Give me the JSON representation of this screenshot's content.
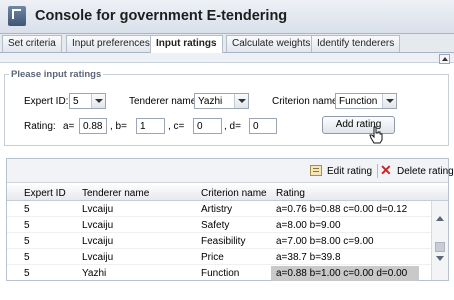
{
  "app": {
    "title": "Console for government E-tendering",
    "logo_icon": "app-logo-icon"
  },
  "tabs": [
    {
      "label": "Set criteria",
      "active": false
    },
    {
      "label": "Input preferences",
      "active": false
    },
    {
      "label": "Input ratings",
      "active": true
    },
    {
      "label": "Calculate weights",
      "active": false
    },
    {
      "label": "Identify tenderers",
      "active": false
    }
  ],
  "form": {
    "legend": "Please input ratings",
    "expert_id_label": "Expert ID:",
    "expert_id_value": "5",
    "tenderer_label": "Tenderer name:",
    "tenderer_value": "Yazhi",
    "criterion_label": "Criterion name:",
    "criterion_value": "Function",
    "rating_label": "Rating:",
    "a_label": "a=",
    "a_value": "0.88",
    "b_label": ", b=",
    "b_value": "1",
    "c_label": ", c=",
    "c_value": "0",
    "d_label": ", d=",
    "d_value": "0",
    "add_button": "Add rating"
  },
  "toolbar": {
    "edit_label": "Edit rating",
    "edit_icon": "edit-icon",
    "delete_label": "Delete rating",
    "delete_icon": "delete-x-icon",
    "delete_color": "#cc2222"
  },
  "table": {
    "columns": [
      "Expert ID",
      "Tenderer name",
      "Criterion name",
      "Rating"
    ],
    "rows": [
      [
        "5",
        "Lvcaiju",
        "Artistry",
        "a=0.76 b=0.88 c=0.00 d=0.12"
      ],
      [
        "5",
        "Lvcaiju",
        "Safety",
        "a=8.00 b=9.00"
      ],
      [
        "5",
        "Lvcaiju",
        "Feasibility",
        "a=7.00 b=8.00 c=9.00"
      ],
      [
        "5",
        "Lvcaiju",
        "Price",
        "a=38.7 b=39.8"
      ],
      [
        "5",
        "Yazhi",
        "Function",
        "a=0.88 b=1.00 c=0.00 d=0.00"
      ]
    ]
  }
}
